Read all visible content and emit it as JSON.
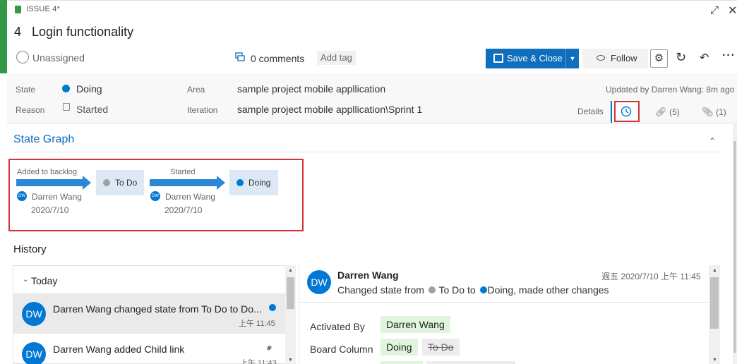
{
  "header": {
    "type_label": "ISSUE 4*",
    "id": "4",
    "title": "Login functionality",
    "assignee": "Unassigned",
    "comments": "0 comments",
    "add_tag": "Add tag",
    "save_close": "Save & Close",
    "follow": "Follow"
  },
  "fields": {
    "state_label": "State",
    "state_value": "Doing",
    "reason_label": "Reason",
    "reason_value": "Started",
    "area_label": "Area",
    "area_value": "sample project mobile appllication",
    "iteration_label": "Iteration",
    "iteration_value": "sample project mobile appllication\\Sprint 1",
    "updated": "Updated by Darren Wang: 8m ago"
  },
  "tabs": {
    "details": "Details",
    "links": "(5)",
    "attachments": "(1)"
  },
  "state_graph": {
    "title": "State Graph",
    "transitions": [
      {
        "label": "Added to backlog",
        "by": "Darren Wang",
        "date": "2020/7/10",
        "initials": "DW"
      },
      {
        "label": "Started",
        "by": "Darren Wang",
        "date": "2020/7/10",
        "initials": "DW"
      }
    ],
    "states": [
      "To Do",
      "Doing"
    ]
  },
  "history": {
    "title": "History",
    "group": "Today",
    "items": [
      {
        "initials": "DW",
        "text": "Darren Wang changed state from To Do to Do...",
        "time": "上午 11:45"
      },
      {
        "initials": "DW",
        "text": "Darren Wang added Child link",
        "time": "上午 11:43"
      }
    ],
    "detail": {
      "initials": "DW",
      "name": "Darren Wang",
      "time": "週五 2020/7/10 上午 11:45",
      "summary_prefix": "Changed state from",
      "from_state": "To Do",
      "to_word": "to",
      "to_state": "Doing, made other changes",
      "changes": [
        {
          "field": "Activated By",
          "new": "Darren Wang",
          "old": ""
        },
        {
          "field": "Board Column",
          "new": "Doing",
          "old": "To Do"
        }
      ]
    }
  },
  "colors": {
    "issue_green": "#339947",
    "accent_blue": "#106ebe",
    "doing_blue": "#007acc",
    "todo_gray": "#a0a0a0",
    "highlight_red": "#d13438"
  }
}
